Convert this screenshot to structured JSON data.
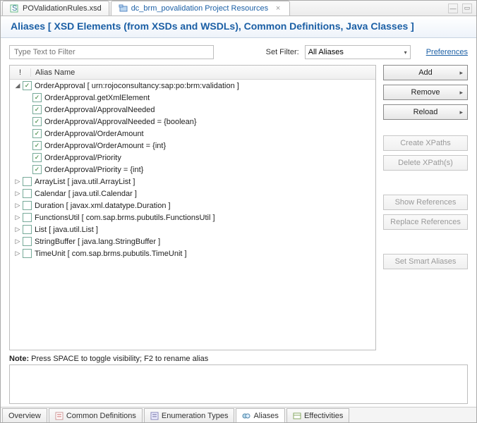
{
  "tabs": {
    "inactive_label": "POValidationRules.xsd",
    "active_label": "dc_brm_povalidation Project Resources",
    "close_glyph": "×"
  },
  "header": {
    "title": "Aliases [  XSD Elements (from XSDs and WSDLs), Common Definitions, Java Classes ]"
  },
  "filter": {
    "placeholder": "Type Text to Filter",
    "set_filter_label": "Set Filter:",
    "selected": "All Aliases",
    "preferences": "Preferences"
  },
  "columns": {
    "excl": "!",
    "name": "Alias Name"
  },
  "rows": [
    {
      "twisty": "open",
      "checked": true,
      "label": "OrderApproval [ urn:rojoconsultancy:sap:po:brm:validation ]"
    },
    {
      "twisty": "none",
      "checked": true,
      "label": "OrderApproval.getXmlElement"
    },
    {
      "twisty": "none",
      "checked": true,
      "label": "OrderApproval/ApprovalNeeded"
    },
    {
      "twisty": "none",
      "checked": true,
      "label": "OrderApproval/ApprovalNeeded = {boolean}"
    },
    {
      "twisty": "none",
      "checked": true,
      "label": "OrderApproval/OrderAmount"
    },
    {
      "twisty": "none",
      "checked": true,
      "label": "OrderApproval/OrderAmount = {int}"
    },
    {
      "twisty": "none",
      "checked": true,
      "label": "OrderApproval/Priority"
    },
    {
      "twisty": "none",
      "checked": true,
      "label": "OrderApproval/Priority = {int}"
    },
    {
      "twisty": "closed",
      "checked": false,
      "label": "ArrayList [ java.util.ArrayList ]"
    },
    {
      "twisty": "closed",
      "checked": false,
      "label": "Calendar [ java.util.Calendar ]"
    },
    {
      "twisty": "closed",
      "checked": false,
      "label": "Duration [ javax.xml.datatype.Duration ]"
    },
    {
      "twisty": "closed",
      "checked": false,
      "label": "FunctionsUtil [ com.sap.brms.pubutils.FunctionsUtil ]"
    },
    {
      "twisty": "closed",
      "checked": false,
      "label": "List [ java.util.List ]"
    },
    {
      "twisty": "closed",
      "checked": false,
      "label": "StringBuffer [ java.lang.StringBuffer ]"
    },
    {
      "twisty": "closed",
      "checked": false,
      "label": "TimeUnit [ com.sap.brms.pubutils.TimeUnit ]"
    }
  ],
  "buttons": {
    "add": "Add",
    "remove": "Remove",
    "reload": "Reload",
    "create_xpaths": "Create XPaths",
    "delete_xpaths": "Delete XPath(s)",
    "show_refs": "Show References",
    "replace_refs": "Replace References",
    "smart_aliases": "Set Smart Aliases"
  },
  "note": {
    "label": "Note:",
    "text": " Press SPACE to toggle visibility; F2 to rename alias"
  },
  "bottom_tabs": {
    "overview": "Overview",
    "common_defs": "Common Definitions",
    "enum_types": "Enumeration Types",
    "aliases": "Aliases",
    "effectivities": "Effectivities"
  }
}
